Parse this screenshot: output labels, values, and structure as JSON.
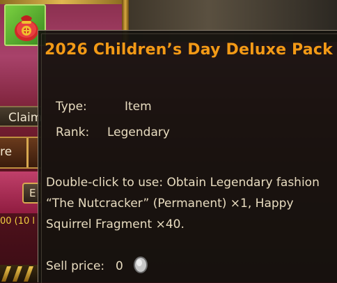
{
  "background": {
    "claim_label": "Claim",
    "tab_label": "re",
    "exp_label": "E",
    "reward_text": "00 (10 l"
  },
  "tooltip": {
    "title": "2026 Children’s Day Deluxe Pack",
    "type_label": "Type:",
    "type_value": "Item",
    "rank_label": "Rank:",
    "rank_value": "Legendary",
    "description": "Double-click to use: Obtain Legendary fashion “The Nutcracker” (Permanent) ×1, Happy Squirrel Fragment ×40.",
    "sell_price_label": "Sell price:",
    "sell_price_value": "0"
  },
  "icons": {
    "item": "gift-bag-icon",
    "currency": "silver-coin-icon"
  },
  "colors": {
    "title": "#f39a16",
    "text": "#e8dcc0",
    "tooltip_bg": "#14120e"
  }
}
